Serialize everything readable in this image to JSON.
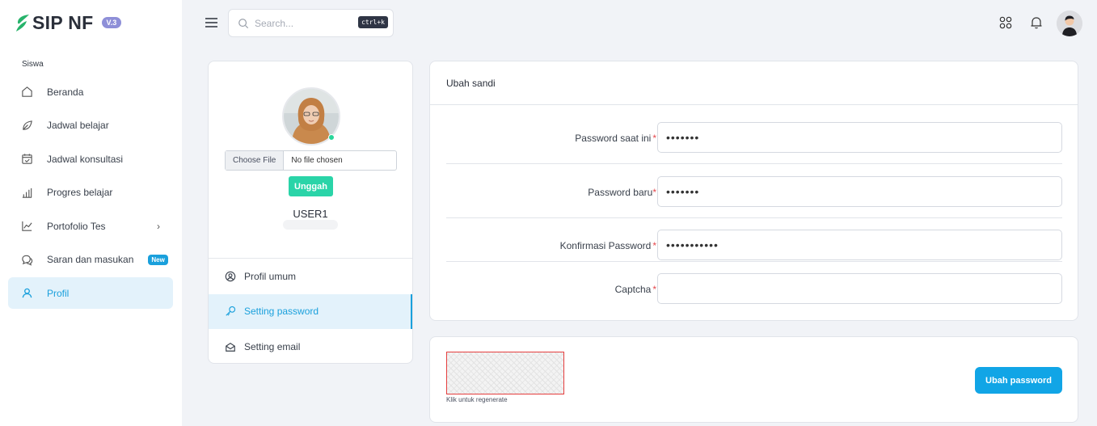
{
  "brand": {
    "name": "SIP NF",
    "version": "V.3",
    "accent": "#27b36b"
  },
  "sidebar": {
    "section": "Siswa",
    "items": [
      {
        "label": "Beranda",
        "icon": "home-icon"
      },
      {
        "label": "Jadwal belajar",
        "icon": "leaf-icon"
      },
      {
        "label": "Jadwal konsultasi",
        "icon": "calendar-check-icon"
      },
      {
        "label": "Progres belajar",
        "icon": "bar-chart-icon"
      },
      {
        "label": "Portofolio Tes",
        "icon": "line-chart-icon"
      },
      {
        "label": "Saran dan masukan",
        "icon": "chat-bubbles-icon",
        "badge": "New"
      },
      {
        "label": "Profil",
        "icon": "user-icon",
        "active": true
      }
    ]
  },
  "topbar": {
    "search_placeholder": "Search...",
    "search_shortcut": "ctrl+k"
  },
  "profile": {
    "choose_file": "Choose File",
    "no_file": "No file chosen",
    "upload_label": "Unggah",
    "username": "USER1",
    "menu": [
      {
        "label": "Profil umum",
        "icon": "user-circle-icon"
      },
      {
        "label": "Setting password",
        "icon": "key-icon",
        "active": true
      },
      {
        "label": "Setting email",
        "icon": "envelope-open-icon"
      }
    ]
  },
  "form": {
    "title": "Ubah sandi",
    "required_mark": "*",
    "current_label": "Password saat ini",
    "current_value": "•••••••",
    "new_label": "Password baru",
    "new_value": "•••••••",
    "confirm_label": "Konfirmasi Password",
    "confirm_value": "•••••••••••",
    "captcha_label": "Captcha",
    "captcha_value": ""
  },
  "captcha": {
    "hint": "Klik untuk regenerate",
    "submit_label": "Ubah password"
  },
  "colors": {
    "primary": "#11a5e6",
    "upload": "#2ad4a8",
    "active_bg": "#e3f2fb",
    "required": "#e5484d"
  }
}
